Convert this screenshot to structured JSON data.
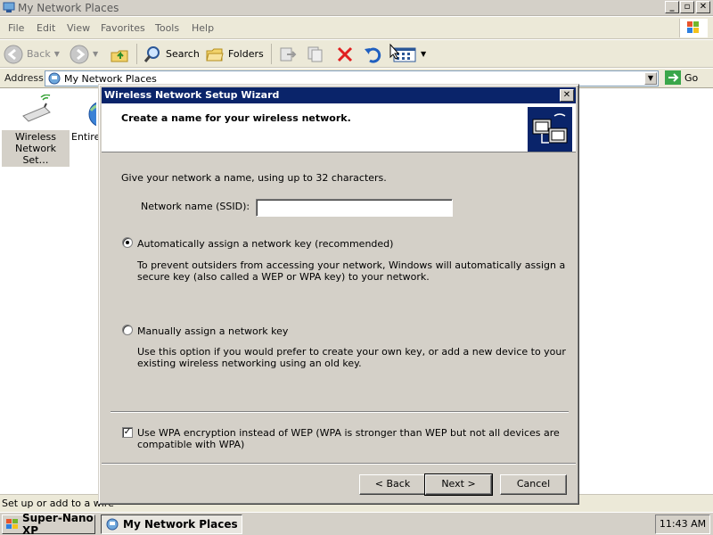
{
  "window": {
    "title": "My Network Places",
    "menu": [
      "File",
      "Edit",
      "View",
      "Favorites",
      "Tools",
      "Help"
    ]
  },
  "toolbar": {
    "back_label": "Back",
    "search_label": "Search",
    "folders_label": "Folders"
  },
  "address": {
    "label": "Address",
    "value": "My Network Places",
    "go_label": "Go"
  },
  "content": {
    "items": [
      {
        "label": "Wireless Network Set…",
        "icon": "wireless-network-icon"
      },
      {
        "label": "Entire",
        "icon": "entire-network-icon"
      }
    ]
  },
  "status": {
    "text": "Set up or add to a wire"
  },
  "taskbar": {
    "start_label": "Super-Nano XP",
    "task_label": "My Network Places",
    "clock": "11:43 AM"
  },
  "dialog": {
    "title": "Wireless Network Setup Wizard",
    "header": "Create a name for your wireless network.",
    "intro": "Give your network a name, using up to 32 characters.",
    "ssid_label": "Network name (SSID):",
    "ssid_value": "",
    "auto_option": "Automatically assign a network key (recommended)",
    "auto_desc_1": "To prevent outsiders from accessing your network, Windows will automatically assign a",
    "auto_desc_2": "secure key (also called a WEP or WPA key) to your network.",
    "manual_option": "Manually assign a network key",
    "manual_desc_1": "Use this option if you would prefer to create your own key, or add a new device to your",
    "manual_desc_2": "existing wireless networking using an old key.",
    "wpa_label_1": "Use WPA encryption instead of WEP (WPA is stronger than WEP but not all devices are",
    "wpa_label_2": "compatible with WPA)",
    "wpa_checked": true,
    "auto_selected": true,
    "back_button": "< Back",
    "next_button": "Next >",
    "cancel_button": "Cancel"
  }
}
